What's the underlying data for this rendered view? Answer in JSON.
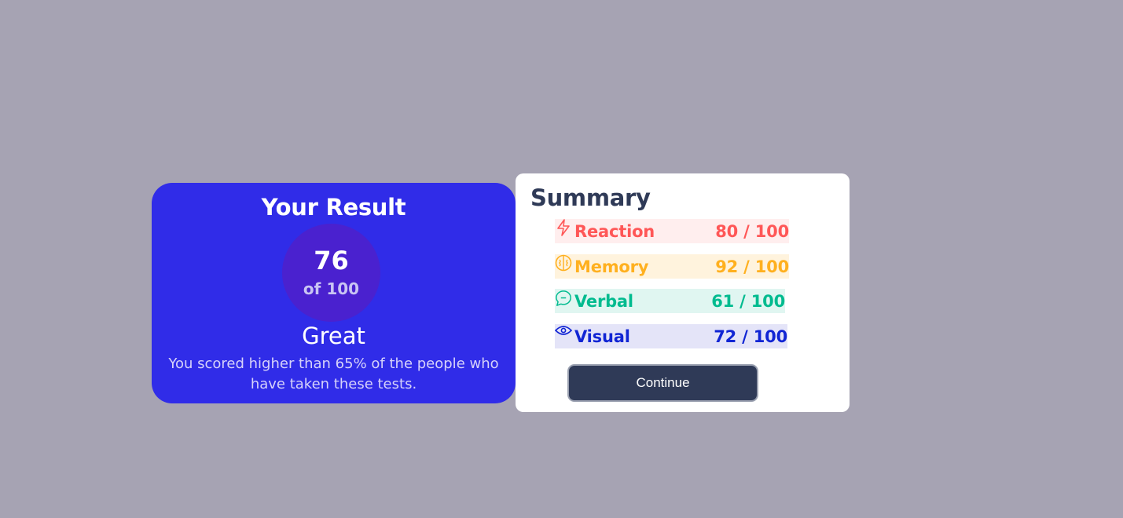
{
  "result": {
    "title": "Your Result",
    "score": "76",
    "score_of": "of 100",
    "grade": "Great",
    "description": "You scored higher than 65% of the people who have taken these tests."
  },
  "summary": {
    "title": "Summary",
    "items": [
      {
        "label": "Reaction",
        "score": "80 / 100",
        "icon": "lightning-icon",
        "color": "#ff5757",
        "bg": "#ffeeee"
      },
      {
        "label": "Memory",
        "score": "92 / 100",
        "icon": "brain-icon",
        "color": "#ffb01f",
        "bg": "#fff3dd"
      },
      {
        "label": "Verbal",
        "score": "61 / 100",
        "icon": "chat-bubble-icon",
        "color": "#00bb8f",
        "bg": "#e0f6f1"
      },
      {
        "label": "Visual",
        "score": "72 / 100",
        "icon": "eye-icon",
        "color": "#1125d4",
        "bg": "#e4e4f8"
      }
    ],
    "continue_label": "Continue"
  }
}
